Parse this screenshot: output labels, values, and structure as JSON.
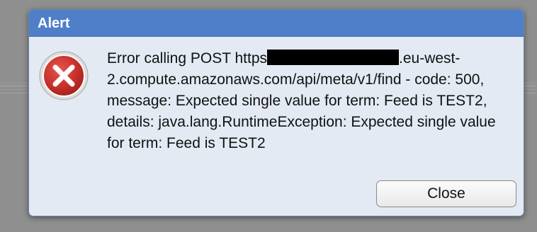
{
  "dialog": {
    "title": "Alert",
    "icon": "error-x-icon",
    "message_prefix": "Error calling POST https",
    "message_suffix": ".eu-west-2.compute.amazonaws.com/api/meta/v1/find - code: 500, message: Expected single value for term: Feed is TEST2, details: java.lang.RuntimeException: Expected single value for term: Feed is TEST2",
    "close_label": "Close"
  },
  "colors": {
    "titlebar": "#4f7fc8",
    "dialog_background": "#e3eaf4",
    "error_icon_red": "#c9302c",
    "backdrop": "#8f8f8f"
  }
}
